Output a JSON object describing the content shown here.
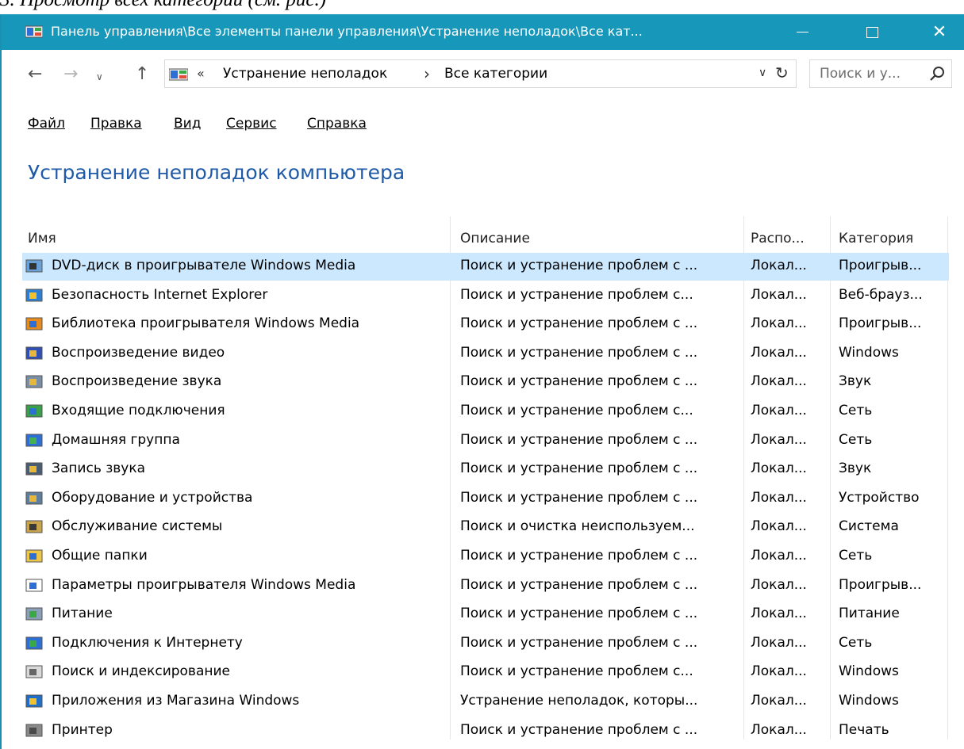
{
  "window": {
    "title": "Панель управления\\Все элементы панели управления\\Устранение неполадок\\Все кат...",
    "accent": "#1797b9"
  },
  "navigation": {
    "breadcrumb_prefix": "«",
    "crumb1": "Устранение неполадок",
    "crumb2": "Все категории",
    "search_placeholder": "Поиск и у..."
  },
  "menu": [
    "Файл",
    "Правка",
    "Вид",
    "Сервис",
    "Справка"
  ],
  "heading": "Устранение неполадок компьютера",
  "table": {
    "columns": [
      "Имя",
      "Описание",
      "Распо...",
      "Категория"
    ],
    "rows": [
      {
        "name": "DVD-диск в проигрывателе Windows Media",
        "description": "Поиск и устранение проблем с ...",
        "location": "Локал...",
        "category": "Проигрыв...",
        "icon": "dvd-icon",
        "selected": true
      },
      {
        "name": "Безопасность Internet Explorer",
        "description": "Поиск и устранение проблем с...",
        "location": "Локал...",
        "category": "Веб-брауз...",
        "icon": "ie-security-icon"
      },
      {
        "name": "Библиотека проигрывателя Windows Media",
        "description": "Поиск и устранение проблем с ...",
        "location": "Локал...",
        "category": "Проигрыв...",
        "icon": "media-library-icon"
      },
      {
        "name": "Воспроизведение видео",
        "description": "Поиск и устранение проблем с ...",
        "location": "Локал...",
        "category": "Windows",
        "icon": "video-playback-icon"
      },
      {
        "name": "Воспроизведение звука",
        "description": "Поиск и устранение проблем с ...",
        "location": "Локал...",
        "category": "Звук",
        "icon": "audio-playback-icon"
      },
      {
        "name": "Входящие подключения",
        "description": "Поиск и устранение проблем с...",
        "location": "Локал...",
        "category": "Сеть",
        "icon": "incoming-connections-icon"
      },
      {
        "name": "Домашняя группа",
        "description": "Поиск и устранение проблем с ...",
        "location": "Локал...",
        "category": "Сеть",
        "icon": "homegroup-icon"
      },
      {
        "name": "Запись звука",
        "description": "Поиск и устранение проблем с ...",
        "location": "Локал...",
        "category": "Звук",
        "icon": "audio-recording-icon"
      },
      {
        "name": "Оборудование и устройства",
        "description": "Поиск и устранение проблем с ...",
        "location": "Локал...",
        "category": "Устройство",
        "icon": "hardware-icon"
      },
      {
        "name": "Обслуживание системы",
        "description": "Поиск и очистка неиспользуем...",
        "location": "Локал...",
        "category": "Система",
        "icon": "system-maintenance-icon"
      },
      {
        "name": "Общие папки",
        "description": "Поиск и устранение проблем с ...",
        "location": "Локал...",
        "category": "Сеть",
        "icon": "shared-folders-icon"
      },
      {
        "name": "Параметры проигрывателя Windows Media",
        "description": "Поиск и устранение проблем с ...",
        "location": "Локал...",
        "category": "Проигрыв...",
        "icon": "media-settings-icon"
      },
      {
        "name": "Питание",
        "description": "Поиск и устранение проблем с ...",
        "location": "Локал...",
        "category": "Питание",
        "icon": "power-icon"
      },
      {
        "name": "Подключения к Интернету",
        "description": "Поиск и устранение проблем с ...",
        "location": "Локал...",
        "category": "Сеть",
        "icon": "internet-connections-icon"
      },
      {
        "name": "Поиск и индексирование",
        "description": "Поиск и устранение проблем с...",
        "location": "Локал...",
        "category": "Windows",
        "icon": "search-indexing-icon"
      },
      {
        "name": "Приложения из Магазина Windows",
        "description": "Устранение неполадок, которы...",
        "location": "Локал...",
        "category": "Windows",
        "icon": "store-apps-icon"
      },
      {
        "name": "Принтер",
        "description": "Поиск и устранение проблем с ...",
        "location": "Локал...",
        "category": "Печать",
        "icon": "printer-icon"
      }
    ]
  }
}
